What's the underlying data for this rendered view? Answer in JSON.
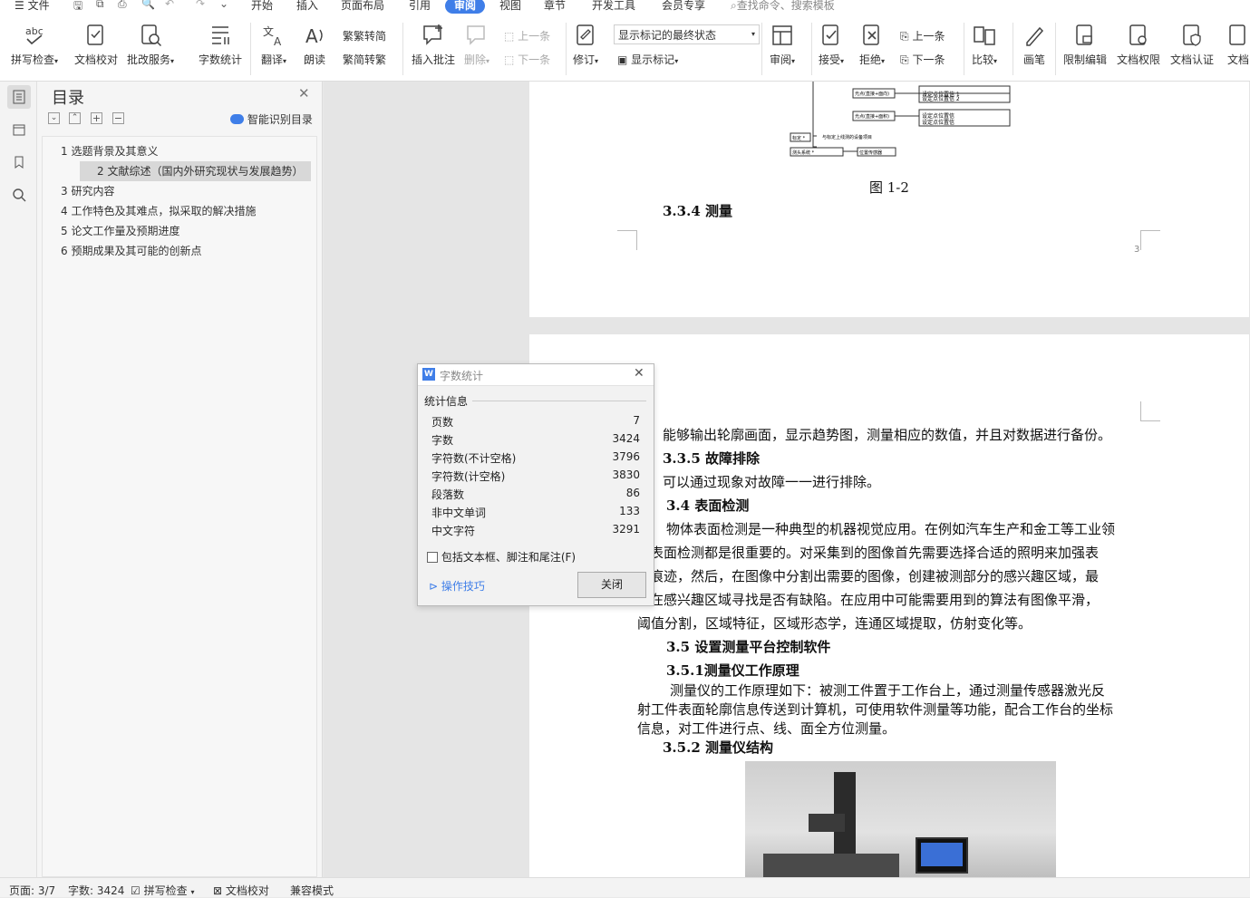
{
  "menubar": {
    "file": "文件",
    "tabs": [
      "开始",
      "插入",
      "页面布局",
      "引用",
      "审阅",
      "视图",
      "章节",
      "开发工具",
      "会员专享"
    ],
    "search": "查找命令、搜索模板"
  },
  "ribbon": {
    "spell": "拼写检查",
    "proof": "文档校对",
    "batch": "批改服务",
    "wordcount": "字数统计",
    "translate": "翻译",
    "read": "朗读",
    "t2s": "繁转简",
    "s2t": "简转繁",
    "insert_comment": "插入批注",
    "delete": "删除",
    "prev": "上一条",
    "next": "下一条",
    "revise": "修订",
    "markup_state": "显示标记的最终状态",
    "show_markup": "显示标记",
    "review": "审阅",
    "accept": "接受",
    "reject": "拒绝",
    "prev2": "上一条",
    "next2": "下一条",
    "compare": "比较",
    "ink": "画笔",
    "restrict": "限制编辑",
    "perm": "文档权限",
    "auth": "文档认证",
    "more": "文档"
  },
  "toc": {
    "title": "目录",
    "smart": "智能识别目录",
    "items": [
      "1  选题背景及其意义",
      "2  文献综述（国内外研究现状与发展趋势）",
      "3  研究内容",
      "4  工作特色及其难点，拟采取的解决措施",
      "5  论文工作量及预期进度",
      "6  预期成果及其可能的创新点"
    ]
  },
  "doc": {
    "fig_caption": "图 1-2",
    "h334": "3.3.4  测量",
    "page_no": "3",
    "p1": "能够输出轮廓画面，显示趋势图，测量相应的数值，并且对数据进行备份。",
    "h335": "3.3.5 故障排除",
    "p2": "可以通过现象对故障一一进行排除。",
    "h34": "3.4 表面检测",
    "p3a": "物体表面检测是一种典型的机器视觉应用。在例如汽车生产和金工等工业领",
    "p3b": "，表面检测都是很重要的。对采集到的图像首先需要选择合适的照明来加强表",
    "p3c": "的痕迹，然后，在图像中分割出需要的图像，创建被测部分的感兴趣区域，最",
    "p3d": "，在感兴趣区域寻找是否有缺陷。在应用中可能需要用到的算法有图像平滑，",
    "p3e": "阈值分割，区域特征，区域形态学，连通区域提取，仿射变化等。",
    "h35": "3.5  设置测量平台控制软件",
    "h351": "3.5.1测量仪工作原理",
    "p4a": "测量仪的工作原理如下：被测工件置于工作台上，通过测量传感器激光反",
    "p4b": "射工件表面轮廓信息传送到计算机，可使用软件测量等功能，配合工作台的坐标",
    "p4c": "信息，对工件进行点、线、面全方位测量。",
    "h352": "3.5.2 测量仪结构",
    "diagram": {
      "b1": "测头系统 *",
      "b2": "位置传感器",
      "b3": "光点(直接+面向)",
      "b4": "光点(直接+面积)",
      "s1": "设定点位置信 1",
      "s2": "设定点位置信 2",
      "s3": "设定点位置信",
      "s4": "设定点位置信",
      "link": "与标定上线测的设备项目",
      "b5": "标定 *"
    }
  },
  "dialog": {
    "title": "字数统计",
    "section": "统计信息",
    "rows": [
      [
        "页数",
        "7"
      ],
      [
        "字数",
        "3424"
      ],
      [
        "字符数(不计空格)",
        "3796"
      ],
      [
        "字符数(计空格)",
        "3830"
      ],
      [
        "段落数",
        "86"
      ],
      [
        "非中文单词",
        "133"
      ],
      [
        "中文字符",
        "3291"
      ]
    ],
    "checkbox": "包括文本框、脚注和尾注(F)",
    "tips": "操作技巧",
    "close": "关闭"
  },
  "status": {
    "page": "页面: 3/7",
    "words": "字数: 3424",
    "spell": "拼写检查",
    "proof": "文档校对",
    "compat": "兼容模式"
  }
}
